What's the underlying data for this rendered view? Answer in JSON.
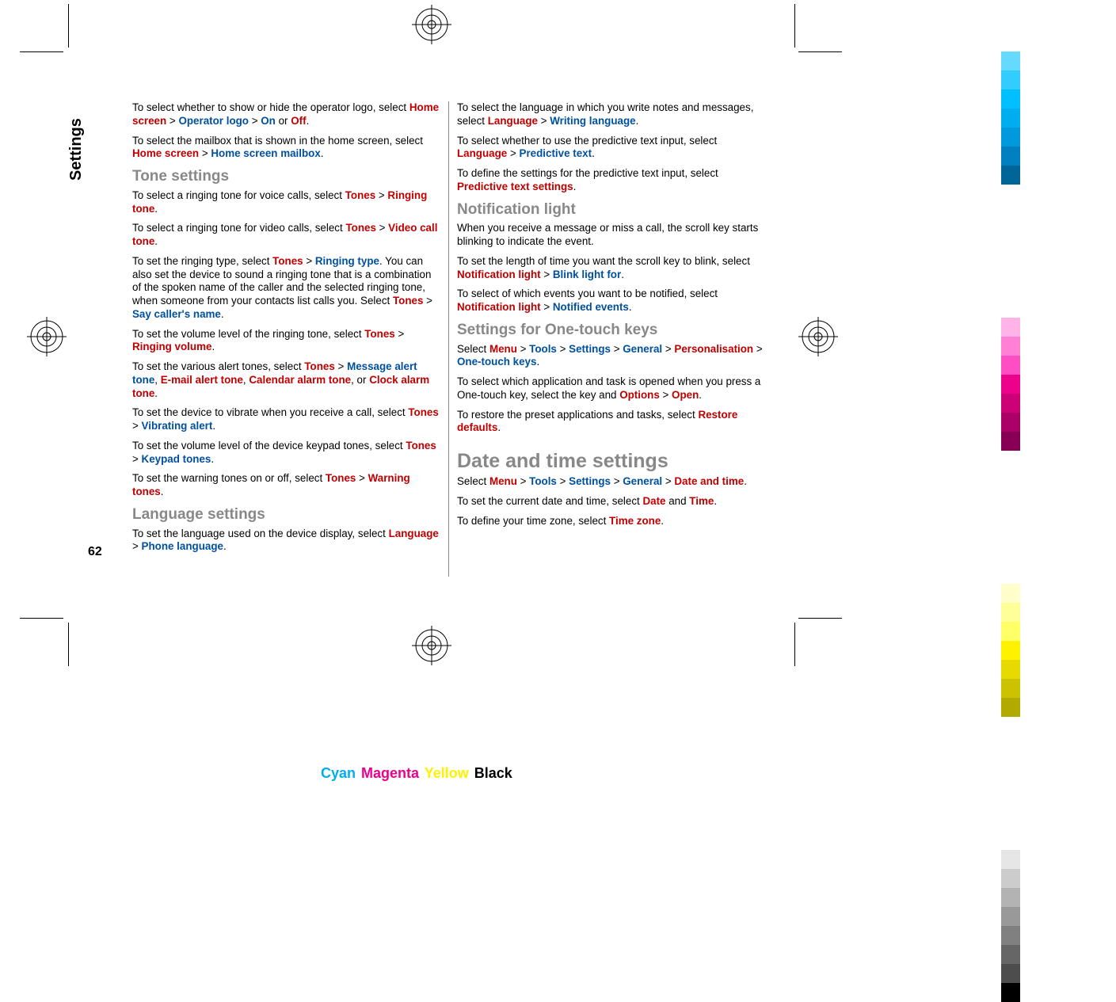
{
  "tab": "Settings",
  "page_number": "62",
  "footer": {
    "cyan": "Cyan",
    "magenta": "Magenta",
    "yellow": "Yellow",
    "black": "Black"
  },
  "color_bars": [
    "#66d9ff",
    "#33ccff",
    "#00bfff",
    "#00aeef",
    "#0099dd",
    "#0080c0",
    "#006699",
    "",
    "",
    "",
    "",
    "",
    "",
    "",
    "#ffb3e6",
    "#ff80d5",
    "#ff4dc4",
    "#ec008c",
    "#cc0077",
    "#aa0066",
    "#880055",
    "",
    "",
    "",
    "",
    "",
    "",
    "",
    "#ffffcc",
    "#ffff99",
    "#ffff66",
    "#fff200",
    "#e6da00",
    "#ccc200",
    "#b3aa00",
    "",
    "",
    "",
    "",
    "",
    "",
    "",
    "#e6e6e6",
    "#cccccc",
    "#b3b3b3",
    "#999999",
    "#808080",
    "#666666",
    "#4d4d4d",
    "#000000"
  ],
  "left_col": {
    "p1_a": "To select whether to show or hide the operator logo, select ",
    "p1_b": "Home screen",
    "p1_c": " > ",
    "p1_d": "Operator logo",
    "p1_e": " > ",
    "p1_f": "On",
    "p1_g": " or ",
    "p1_h": "Off",
    "p1_i": ".",
    "p2_a": "To select the mailbox that is shown in the home screen, select ",
    "p2_b": "Home screen",
    "p2_c": " > ",
    "p2_d": "Home screen mailbox",
    "p2_e": ".",
    "h_tone": "Tone settings",
    "p3_a": "To select a ringing tone for voice calls, select ",
    "p3_b": "Tones",
    "p3_c": " > ",
    "p3_d": "Ringing tone",
    "p3_e": ".",
    "p4_a": "To select a ringing tone for video calls, select ",
    "p4_b": "Tones",
    "p4_c": " > ",
    "p4_d": "Video call tone",
    "p4_e": ".",
    "p5_a": "To set the ringing type, select ",
    "p5_b": "Tones",
    "p5_c": " > ",
    "p5_d": "Ringing type",
    "p5_e": ". You can also set the device to sound a ringing tone that is a combination of the spoken name of the caller and the selected ringing tone, when someone from your contacts list calls you. Select ",
    "p5_f": "Tones",
    "p5_g": " > ",
    "p5_h": "Say caller's name",
    "p5_i": ".",
    "p6_a": "To set the volume level of the ringing tone, select ",
    "p6_b": "Tones",
    "p6_c": " > ",
    "p6_d": "Ringing volume",
    "p6_e": ".",
    "p7_a": "To set the various alert tones, select ",
    "p7_b": "Tones",
    "p7_c": " > ",
    "p7_d": "Message alert tone",
    "p7_e": ", ",
    "p7_f": "E-mail alert tone",
    "p7_g": ", ",
    "p7_h": "Calendar alarm tone",
    "p7_i": ", or ",
    "p7_j": "Clock alarm tone",
    "p7_k": ".",
    "p8_a": "To set the device to vibrate when you receive a call, select ",
    "p8_b": "Tones",
    "p8_c": " > ",
    "p8_d": "Vibrating alert",
    "p8_e": ".",
    "p9_a": "To set the volume level of the device keypad tones, select ",
    "p9_b": "Tones",
    "p9_c": " > ",
    "p9_d": "Keypad tones",
    "p9_e": ".",
    "p10_a": "To set the warning tones on or off, select ",
    "p10_b": "Tones",
    "p10_c": " > ",
    "p10_d": "Warning tones",
    "p10_e": ".",
    "h_lang": "Language settings",
    "p11_a": "To set the language used on the device display, select ",
    "p11_b": "Language",
    "p11_c": " > ",
    "p11_d": "Phone language",
    "p11_e": "."
  },
  "right_col": {
    "p1_a": "To select the language in which you write notes and messages, select ",
    "p1_b": "Language",
    "p1_c": " > ",
    "p1_d": "Writing language",
    "p1_e": ".",
    "p2_a": "To select whether to use the predictive text input, select ",
    "p2_b": "Language",
    "p2_c": " > ",
    "p2_d": "Predictive text",
    "p2_e": ".",
    "p3_a": "To define the settings for the predictive text input, select ",
    "p3_b": "Predictive text settings",
    "p3_c": ".",
    "h_notif": "Notification light",
    "p4": "When you receive a message or miss a call, the scroll key starts blinking to indicate the event.",
    "p5_a": "To set the length of time you want the scroll key to blink, select ",
    "p5_b": "Notification light",
    "p5_c": " > ",
    "p5_d": "Blink light for",
    "p5_e": ".",
    "p6_a": "To select of which events you want to be notified, select ",
    "p6_b": "Notification light",
    "p6_c": " > ",
    "p6_d": "Notified events",
    "p6_e": ".",
    "h_onetouch": "Settings for One-touch keys",
    "p7_a": "Select ",
    "p7_b": "Menu",
    "p7_c": " > ",
    "p7_d": "Tools",
    "p7_e": " > ",
    "p7_f": "Settings",
    "p7_g": " > ",
    "p7_h": "General",
    "p7_i": " > ",
    "p7_j": "Personalisation",
    "p7_k": " > ",
    "p7_l": "One-touch keys",
    "p7_m": ".",
    "p8_a": "To select which application and task is opened when you press a One-touch key, select the key and ",
    "p8_b": "Options",
    "p8_c": " > ",
    "p8_d": "Open",
    "p8_e": ".",
    "p9_a": "To restore the preset applications and tasks, select ",
    "p9_b": "Restore defaults",
    "p9_c": ".",
    "h_datetime": "Date and time settings",
    "p10_a": "Select ",
    "p10_b": "Menu",
    "p10_c": " > ",
    "p10_d": "Tools",
    "p10_e": " > ",
    "p10_f": "Settings",
    "p10_g": " > ",
    "p10_h": "General",
    "p10_i": " > ",
    "p10_j": "Date and time",
    "p10_k": ".",
    "p11_a": "To set the current date and time, select ",
    "p11_b": "Date",
    "p11_c": " and ",
    "p11_d": "Time",
    "p11_e": ".",
    "p12_a": "To define your time zone, select ",
    "p12_b": "Time zone",
    "p12_c": "."
  }
}
